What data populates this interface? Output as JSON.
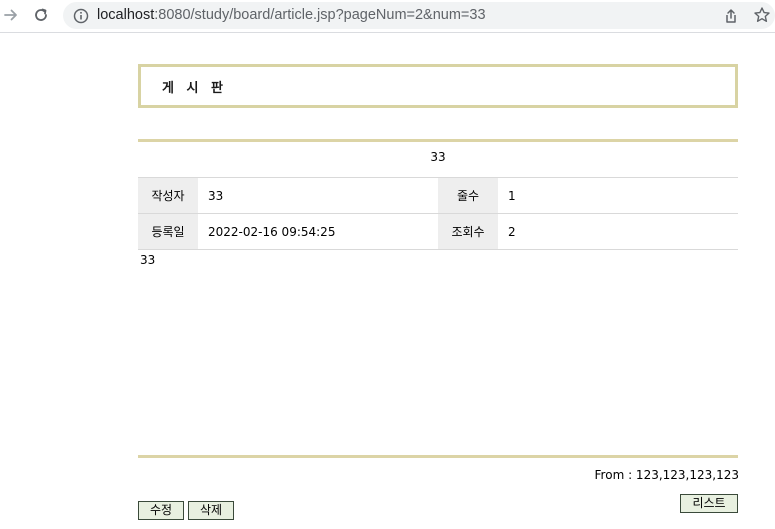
{
  "browser": {
    "url_host": "localhost",
    "url_rest": ":8080/study/board/article.jsp?pageNum=2&num=33"
  },
  "board": {
    "title": "게 시 판",
    "subject": "33",
    "rows": [
      {
        "label1": "작성자",
        "value1": "33",
        "label2": "줄수",
        "value2": "1"
      },
      {
        "label1": "등록일",
        "value1": "2022-02-16 09:54:25",
        "label2": "조회수",
        "value2": "2"
      }
    ],
    "content": "33",
    "from": "From : 123,123,123,123"
  },
  "buttons": {
    "edit": "수정",
    "delete": "삭제",
    "list": "리스트"
  },
  "colors": {
    "accent_border": "#d8d3a3",
    "label_bg": "#eeeeee",
    "button_bg": "#e8f0e0"
  }
}
